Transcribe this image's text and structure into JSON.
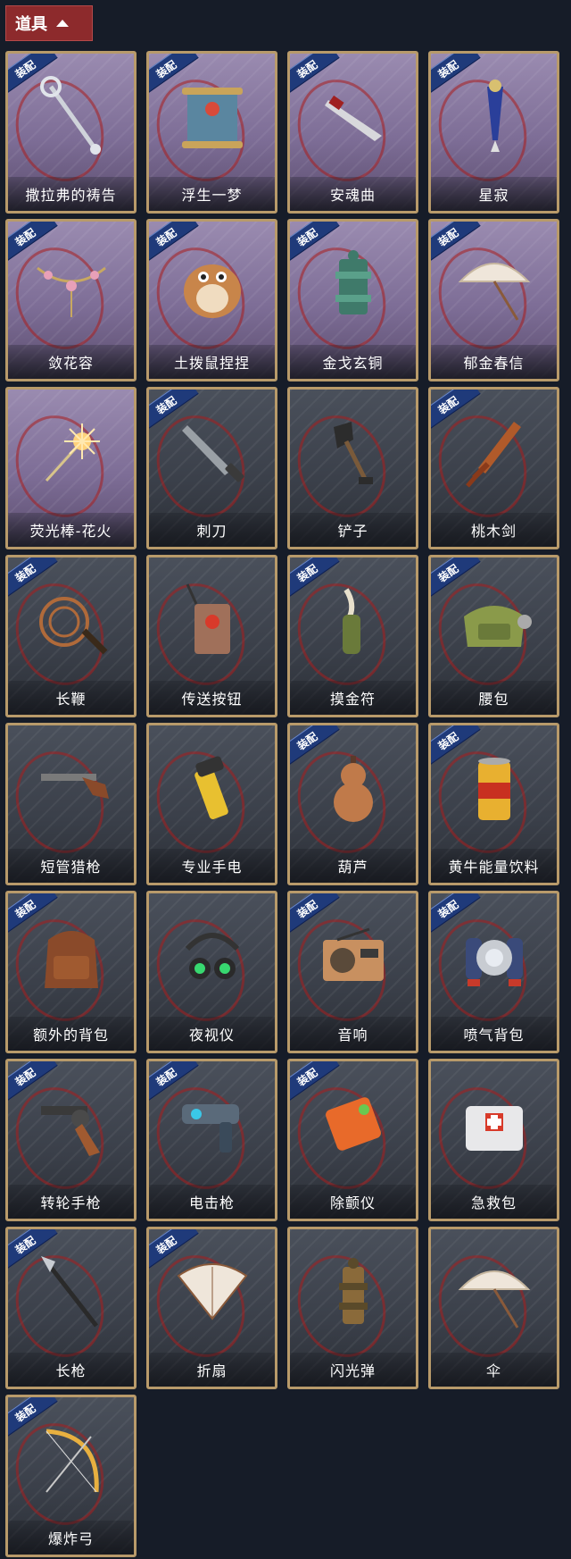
{
  "header": {
    "title": "道具"
  },
  "equip_tag": "装配",
  "items": [
    {
      "name": "撒拉弗的祷告",
      "icon": "staff-icon",
      "equipped": true,
      "rare": true
    },
    {
      "name": "浮生一梦",
      "icon": "scroll-icon",
      "equipped": true,
      "rare": true
    },
    {
      "name": "安魂曲",
      "icon": "dagger-icon",
      "equipped": true,
      "rare": true
    },
    {
      "name": "星寂",
      "icon": "scepter-icon",
      "equipped": true,
      "rare": true
    },
    {
      "name": "敛花容",
      "icon": "flower-chain-icon",
      "equipped": true,
      "rare": true
    },
    {
      "name": "土拨鼠捏捏",
      "icon": "hamster-icon",
      "equipped": true,
      "rare": true
    },
    {
      "name": "金戈玄铜",
      "icon": "bronze-grenade-icon",
      "equipped": true,
      "rare": true
    },
    {
      "name": "郁金春信",
      "icon": "umbrella-icon",
      "equipped": true,
      "rare": true
    },
    {
      "name": "荧光棒-花火",
      "icon": "sparkler-icon",
      "equipped": false,
      "rare": true
    },
    {
      "name": "刺刀",
      "icon": "knife-icon",
      "equipped": true,
      "rare": false
    },
    {
      "name": "铲子",
      "icon": "shovel-icon",
      "equipped": false,
      "rare": false
    },
    {
      "name": "桃木剑",
      "icon": "wooden-sword-icon",
      "equipped": true,
      "rare": false
    },
    {
      "name": "长鞭",
      "icon": "whip-icon",
      "equipped": true,
      "rare": false
    },
    {
      "name": "传送按钮",
      "icon": "remote-icon",
      "equipped": false,
      "rare": false
    },
    {
      "name": "摸金符",
      "icon": "talisman-icon",
      "equipped": true,
      "rare": false
    },
    {
      "name": "腰包",
      "icon": "waist-bag-icon",
      "equipped": true,
      "rare": false
    },
    {
      "name": "短管猎枪",
      "icon": "shotgun-icon",
      "equipped": false,
      "rare": false
    },
    {
      "name": "专业手电",
      "icon": "flashlight-icon",
      "equipped": false,
      "rare": false
    },
    {
      "name": "葫芦",
      "icon": "gourd-icon",
      "equipped": true,
      "rare": false
    },
    {
      "name": "黄牛能量饮料",
      "icon": "energy-drink-icon",
      "equipped": true,
      "rare": false
    },
    {
      "name": "额外的背包",
      "icon": "backpack-icon",
      "equipped": true,
      "rare": false
    },
    {
      "name": "夜视仪",
      "icon": "night-vision-icon",
      "equipped": false,
      "rare": false
    },
    {
      "name": "音响",
      "icon": "radio-icon",
      "equipped": true,
      "rare": false
    },
    {
      "name": "喷气背包",
      "icon": "jetpack-icon",
      "equipped": true,
      "rare": false
    },
    {
      "name": "转轮手枪",
      "icon": "revolver-icon",
      "equipped": true,
      "rare": false
    },
    {
      "name": "电击枪",
      "icon": "taser-icon",
      "equipped": true,
      "rare": false
    },
    {
      "name": "除颤仪",
      "icon": "defibrillator-icon",
      "equipped": true,
      "rare": false
    },
    {
      "name": "急救包",
      "icon": "first-aid-icon",
      "equipped": false,
      "rare": false
    },
    {
      "name": "长枪",
      "icon": "spear-icon",
      "equipped": true,
      "rare": false
    },
    {
      "name": "折扇",
      "icon": "fan-icon",
      "equipped": true,
      "rare": false
    },
    {
      "name": "闪光弹",
      "icon": "flashbang-icon",
      "equipped": false,
      "rare": false
    },
    {
      "name": "伞",
      "icon": "umbrella-icon",
      "equipped": false,
      "rare": false
    },
    {
      "name": "爆炸弓",
      "icon": "bow-icon",
      "equipped": true,
      "rare": false
    }
  ]
}
